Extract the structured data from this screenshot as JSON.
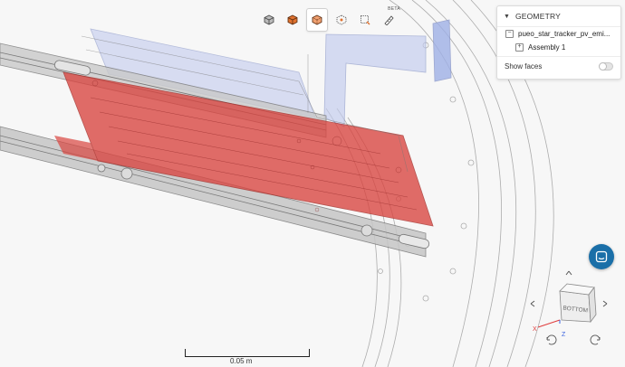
{
  "toolbar": {
    "buttons": [
      {
        "name": "view-cube-button",
        "icon": "cube-shaded-icon"
      },
      {
        "name": "section-box-button",
        "icon": "cube-orange-icon"
      },
      {
        "name": "display-mode-button",
        "icon": "cube-transparent-icon",
        "active": true
      },
      {
        "name": "explode-button",
        "icon": "cube-points-icon"
      },
      {
        "name": "box-select-button",
        "icon": "box-select-icon"
      },
      {
        "name": "measure-button",
        "icon": "measure-icon",
        "badge": "BETA"
      }
    ]
  },
  "geometry_panel": {
    "title": "GEOMETRY",
    "root_item": "pueo_star_tracker_pv_emi...",
    "child_item": "Assembly 1",
    "show_faces_label": "Show faces",
    "show_faces_on": false
  },
  "scale": {
    "label": "0.05 m"
  },
  "nav_cube": {
    "face_label": "BOTTOM",
    "axis_x": "X",
    "axis_z": "Z"
  },
  "colors": {
    "accent": "#1a6fa8",
    "part_red": "#d9443f",
    "part_blue": "#b8c4ea",
    "rail": "#9a9a9a"
  }
}
